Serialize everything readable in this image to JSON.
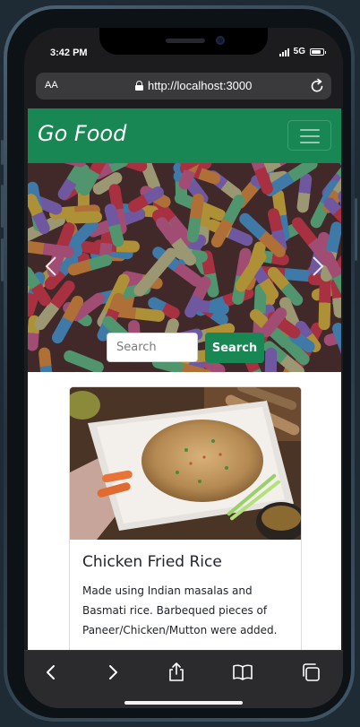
{
  "status": {
    "time": "3:42 PM",
    "network": "5G",
    "battery_level": 0.85
  },
  "browser": {
    "text_size_label": "AA",
    "url": "http://localhost:3000"
  },
  "navbar": {
    "brand": "Go Food"
  },
  "search": {
    "placeholder": "Search",
    "button_label": "Search"
  },
  "card": {
    "title": "Chicken Fried Rice",
    "description": "Made using Indian masalas and Basmati rice. Barbequed pieces of Paneer/Chicken/Mutton were added."
  },
  "toolbar": {
    "icons": [
      "back-icon",
      "forward-icon",
      "share-icon",
      "bookmarks-icon",
      "tabs-icon"
    ]
  },
  "colors": {
    "brand_green": "#198754",
    "frame_blue": "#3f5566"
  }
}
